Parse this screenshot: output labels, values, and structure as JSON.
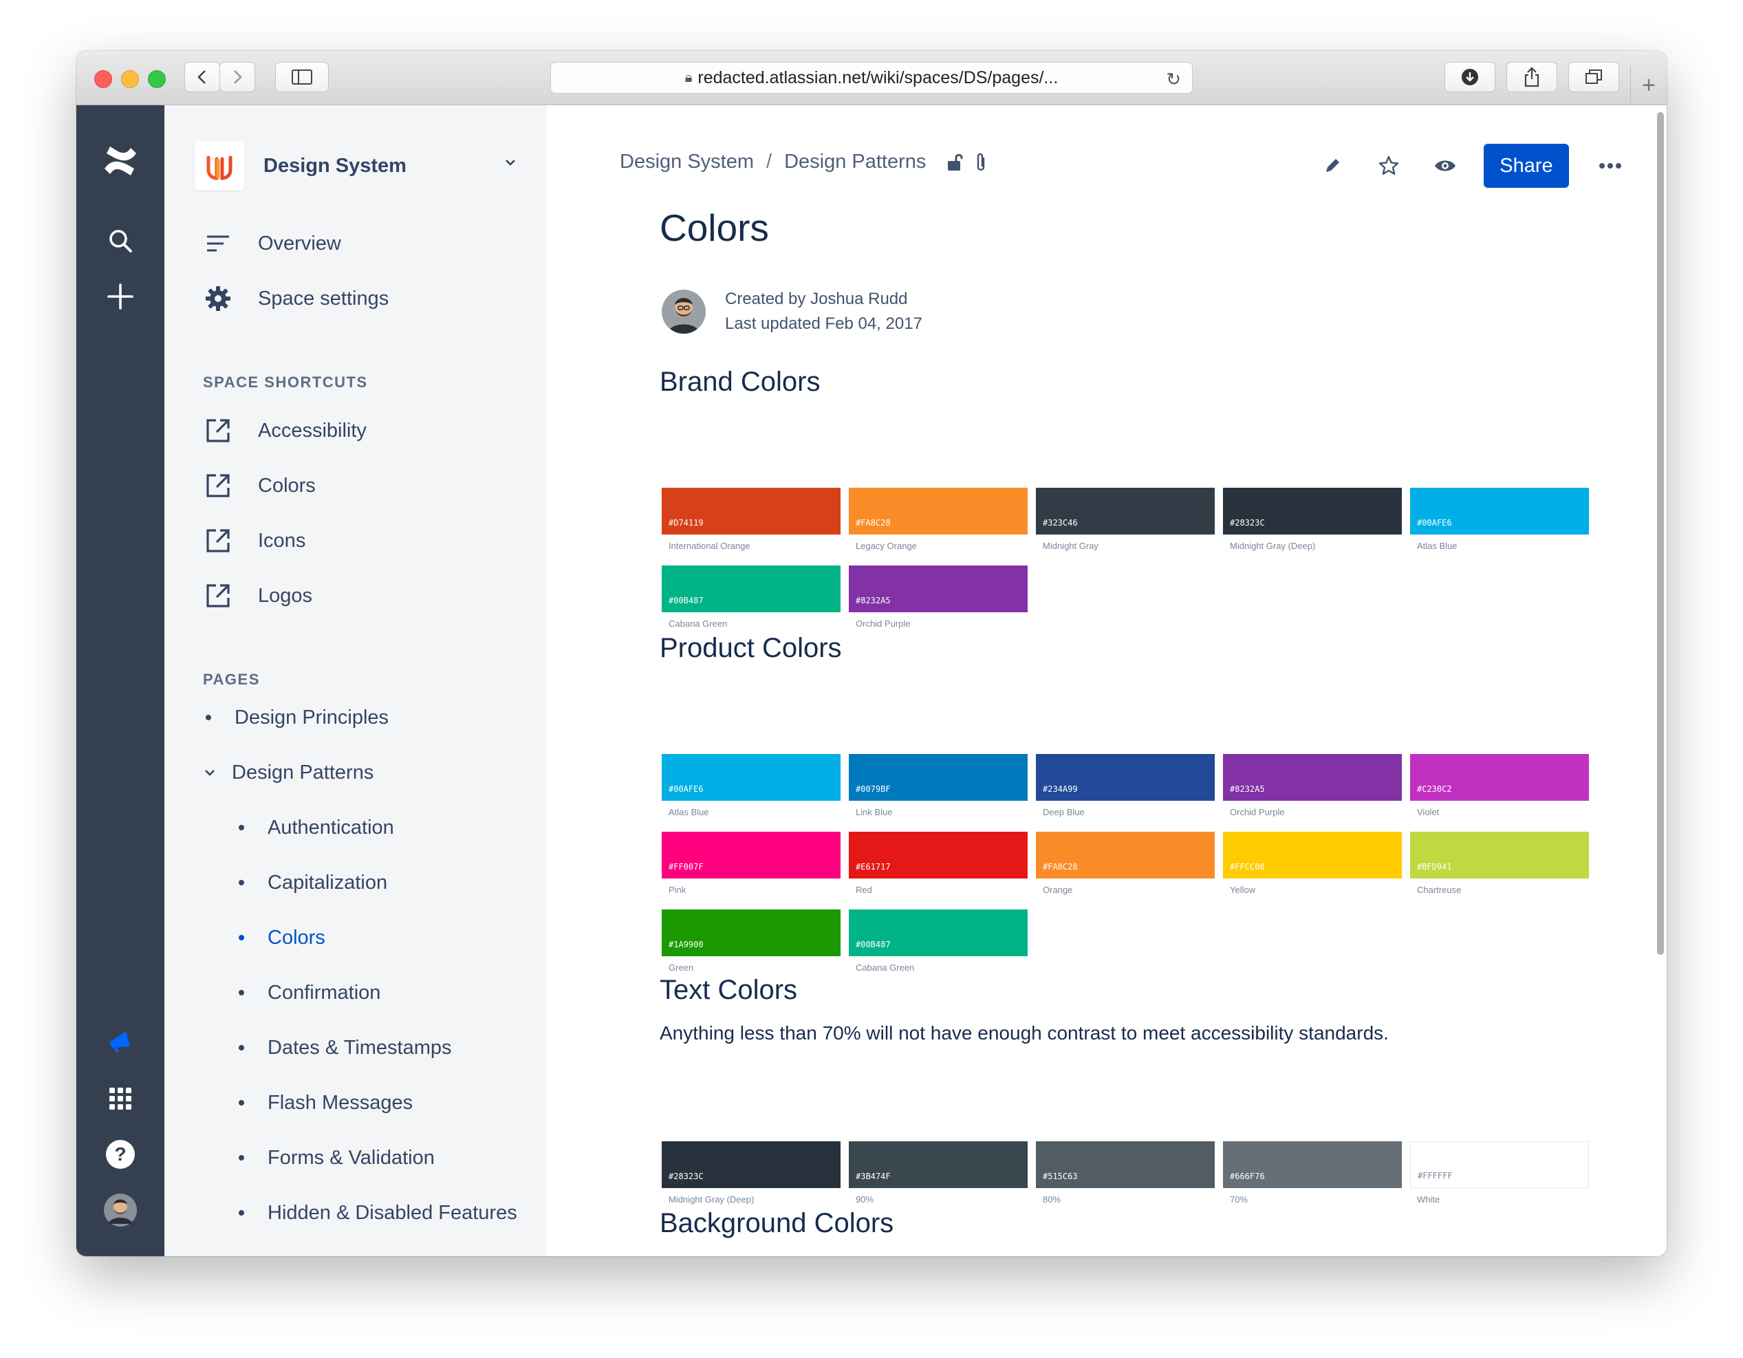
{
  "browser": {
    "url": "redacted.atlassian.net/wiki/spaces/DS/pages/..."
  },
  "space": {
    "title": "Design System",
    "nav": [
      {
        "label": "Overview",
        "icon": "overview-icon"
      },
      {
        "label": "Space settings",
        "icon": "gear-icon"
      }
    ],
    "shortcuts_label": "SPACE SHORTCUTS",
    "shortcuts": [
      "Accessibility",
      "Colors",
      "Icons",
      "Logos"
    ],
    "pages_label": "PAGES",
    "pages": [
      {
        "label": "Design Principles",
        "level": 0
      },
      {
        "label": "Design Patterns",
        "level": 0,
        "expanded": true
      },
      {
        "label": "Authentication",
        "level": 1
      },
      {
        "label": "Capitalization",
        "level": 1
      },
      {
        "label": "Colors",
        "level": 1,
        "active": true
      },
      {
        "label": "Confirmation",
        "level": 1
      },
      {
        "label": "Dates & Timestamps",
        "level": 1
      },
      {
        "label": "Flash Messages",
        "level": 1
      },
      {
        "label": "Forms & Validation",
        "level": 1
      },
      {
        "label": "Hidden & Disabled Features",
        "level": 1
      }
    ]
  },
  "breadcrumb": [
    "Design System",
    "Design Patterns"
  ],
  "actions": {
    "share": "Share"
  },
  "page": {
    "title": "Colors",
    "created_by": "Created by Joshua Rudd",
    "updated": "Last updated Feb 04, 2017"
  },
  "sections": {
    "brand": {
      "title": "Brand Colors",
      "swatches": [
        {
          "hex": "#D74119",
          "name": "International Orange"
        },
        {
          "hex": "#FA8C28",
          "name": "Legacy Orange"
        },
        {
          "hex": "#323C46",
          "name": "Midnight Gray"
        },
        {
          "hex": "#28323C",
          "name": "Midnight Gray (Deep)"
        },
        {
          "hex": "#00AFE6",
          "name": "Atlas Blue"
        },
        {
          "hex": "#00B487",
          "name": "Cabana Green"
        },
        {
          "hex": "#8232A5",
          "name": "Orchid Purple"
        }
      ]
    },
    "product": {
      "title": "Product Colors",
      "swatches": [
        {
          "hex": "#00AFE6",
          "name": "Atlas Blue"
        },
        {
          "hex": "#0079BF",
          "name": "Link Blue"
        },
        {
          "hex": "#234A99",
          "name": "Deep Blue"
        },
        {
          "hex": "#8232A5",
          "name": "Orchid Purple"
        },
        {
          "hex": "#C230C2",
          "name": "Violet"
        },
        {
          "hex": "#FF007F",
          "name": "Pink"
        },
        {
          "hex": "#E61717",
          "name": "Red"
        },
        {
          "hex": "#FA8C28",
          "name": "Orange"
        },
        {
          "hex": "#FFCC00",
          "name": "Yellow"
        },
        {
          "hex": "#BFD941",
          "name": "Chartreuse"
        },
        {
          "hex": "#1A9900",
          "name": "Green"
        },
        {
          "hex": "#00B487",
          "name": "Cabana Green"
        }
      ]
    },
    "text": {
      "title": "Text Colors",
      "description": "Anything less than 70% will not have enough contrast to meet accessibility standards.",
      "swatches": [
        {
          "hex": "#28323C",
          "name": "Midnight Gray (Deep)"
        },
        {
          "hex": "#3B474F",
          "name": "90%"
        },
        {
          "hex": "#515C63",
          "name": "80%"
        },
        {
          "hex": "#666F76",
          "name": "70%"
        },
        {
          "hex": "#FFFFFF",
          "name": "White"
        }
      ]
    },
    "background": {
      "title": "Background Colors"
    }
  },
  "colors": {
    "global_nav": "#344050",
    "space_nav": "#F4F5F7",
    "primary": "#0052CC"
  }
}
